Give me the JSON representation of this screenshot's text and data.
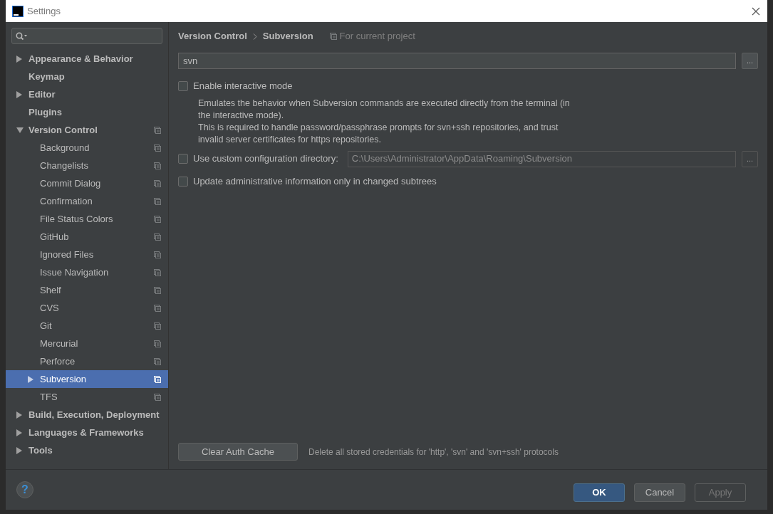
{
  "window": {
    "title": "Settings"
  },
  "sidebar": {
    "items": [
      {
        "label": "Appearance & Behavior",
        "expanded": false,
        "selected": false,
        "project_level": false
      },
      {
        "label": "Keymap",
        "selected": false,
        "project_level": false
      },
      {
        "label": "Editor",
        "expanded": false,
        "selected": false,
        "project_level": false
      },
      {
        "label": "Plugins",
        "selected": false,
        "project_level": false
      },
      {
        "label": "Version Control",
        "expanded": true,
        "selected": false,
        "project_level": true,
        "children": [
          {
            "label": "Background",
            "selected": false,
            "project_level": true
          },
          {
            "label": "Changelists",
            "selected": false,
            "project_level": true
          },
          {
            "label": "Commit Dialog",
            "selected": false,
            "project_level": true
          },
          {
            "label": "Confirmation",
            "selected": false,
            "project_level": true
          },
          {
            "label": "File Status Colors",
            "selected": false,
            "project_level": true
          },
          {
            "label": "GitHub",
            "selected": false,
            "project_level": true
          },
          {
            "label": "Ignored Files",
            "selected": false,
            "project_level": true
          },
          {
            "label": "Issue Navigation",
            "selected": false,
            "project_level": true
          },
          {
            "label": "Shelf",
            "selected": false,
            "project_level": true
          },
          {
            "label": "CVS",
            "selected": false,
            "project_level": true
          },
          {
            "label": "Git",
            "selected": false,
            "project_level": true
          },
          {
            "label": "Mercurial",
            "selected": false,
            "project_level": true
          },
          {
            "label": "Perforce",
            "selected": false,
            "project_level": true
          },
          {
            "label": "Subversion",
            "expanded": false,
            "selected": true,
            "project_level": true
          },
          {
            "label": "TFS",
            "selected": false,
            "project_level": true
          }
        ]
      },
      {
        "label": "Build, Execution, Deployment",
        "expanded": false,
        "selected": false,
        "project_level": false
      },
      {
        "label": "Languages & Frameworks",
        "expanded": false,
        "selected": false,
        "project_level": false
      },
      {
        "label": "Tools",
        "expanded": false,
        "selected": false,
        "project_level": false
      }
    ]
  },
  "breadcrumb": {
    "items": [
      "Version Control",
      "Subversion"
    ],
    "scope": "For current project"
  },
  "path_field": {
    "value": "svn",
    "button": "..."
  },
  "options": [
    {
      "kind": "checkbox",
      "label": "Enable interactive mode",
      "checked": false,
      "description": [
        "Emulates the behavior when Subversion commands are executed directly from the terminal (in",
        "the interactive mode).",
        "This is required to handle password/passphrase prompts for svn+ssh repositories, and trust",
        "invalid server certificates for https repositories."
      ]
    },
    {
      "kind": "path",
      "label": "Use custom configuration directory:",
      "checked": false,
      "value": "C:\\Users\\Administrator\\AppData\\Roaming\\Subversion",
      "button": "..."
    },
    {
      "kind": "checkbox",
      "label": "Update administrative information only in changed subtrees",
      "checked": false
    }
  ],
  "auth": {
    "button": "Clear Auth Cache",
    "note": "Delete all stored credentials for 'http', 'svn' and 'svn+ssh' protocols"
  },
  "footer": {
    "help": "?",
    "buttons": [
      {
        "label": "OK",
        "default": true,
        "disabled": false
      },
      {
        "label": "Cancel",
        "default": false,
        "disabled": false
      },
      {
        "label": "Apply",
        "default": false,
        "disabled": true
      }
    ]
  }
}
